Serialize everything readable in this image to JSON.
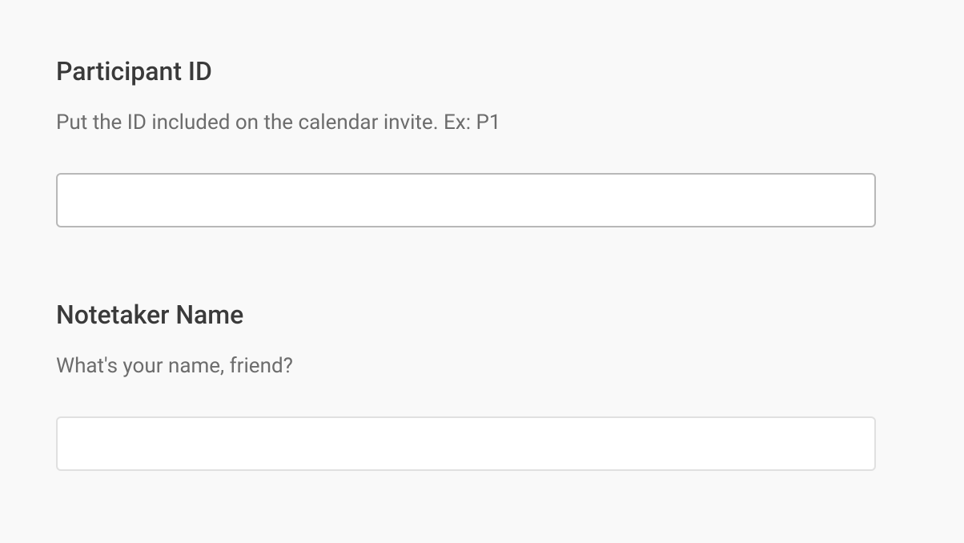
{
  "form": {
    "fields": [
      {
        "label": "Participant ID",
        "description": "Put the ID included on the calendar invite. Ex: P1",
        "value": ""
      },
      {
        "label": "Notetaker Name",
        "description": "What's your name, friend?",
        "value": ""
      }
    ]
  }
}
